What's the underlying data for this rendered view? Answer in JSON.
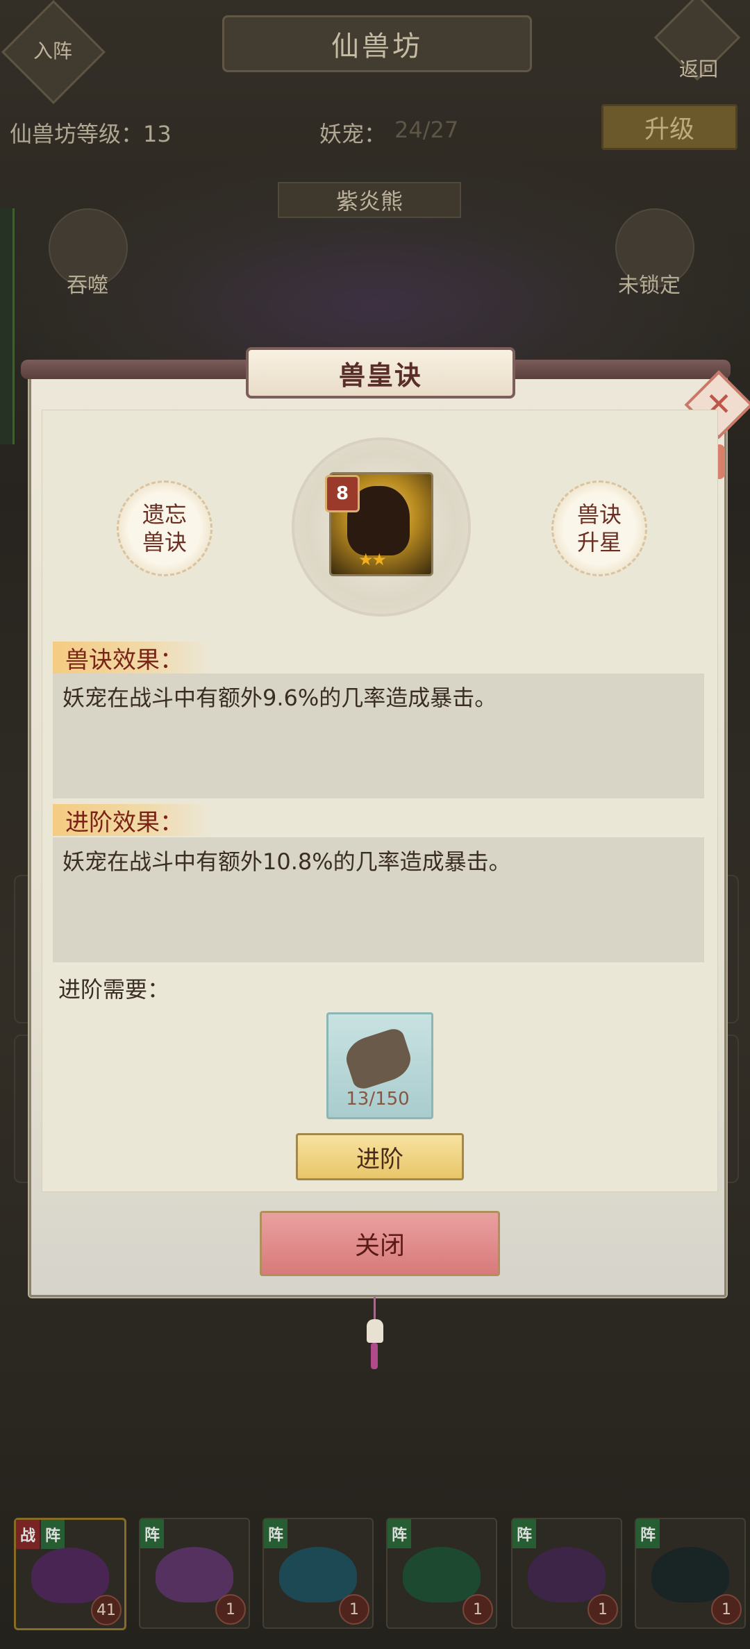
{
  "header": {
    "title": "仙兽坊",
    "left_button_label": "入阵",
    "back_label": "返回"
  },
  "info": {
    "level_text": "仙兽坊等级：13",
    "pets_label": "妖宠：",
    "pets_value": "24/27",
    "upgrade_label": "升级"
  },
  "pet": {
    "name": "紫炎熊",
    "devour_label": "吞噬",
    "lock_label": "未锁定"
  },
  "modal": {
    "title": "兽皇诀",
    "forget_line1": "遗忘",
    "forget_line2": "兽诀",
    "star_line1": "兽诀",
    "star_line2": "升星",
    "skill_level": "8",
    "stars": "★★",
    "effect_head": "兽诀效果：",
    "effect_text": "妖宠在战斗中有额外9.6%的几率造成暴击。",
    "advance_head": "进阶效果：",
    "advance_text": "妖宠在战斗中有额外10.8%的几率造成暴击。",
    "need_label": "进阶需要：",
    "item_count": "13/150",
    "advance_button": "进阶",
    "close_button": "关闭"
  },
  "pet_strip": [
    {
      "tags": [
        "战",
        "阵"
      ],
      "level": "41",
      "color": "#5a2a6a"
    },
    {
      "tags": [
        "阵"
      ],
      "level": "1",
      "color": "#6a3a7a"
    },
    {
      "tags": [
        "阵"
      ],
      "level": "1",
      "color": "#1f5a6a"
    },
    {
      "tags": [
        "阵"
      ],
      "level": "1",
      "color": "#1f5a3a"
    },
    {
      "tags": [
        "阵"
      ],
      "level": "1",
      "color": "#4a2a5a"
    },
    {
      "tags": [
        "阵"
      ],
      "level": "1",
      "color": "#1a2a2a"
    }
  ]
}
